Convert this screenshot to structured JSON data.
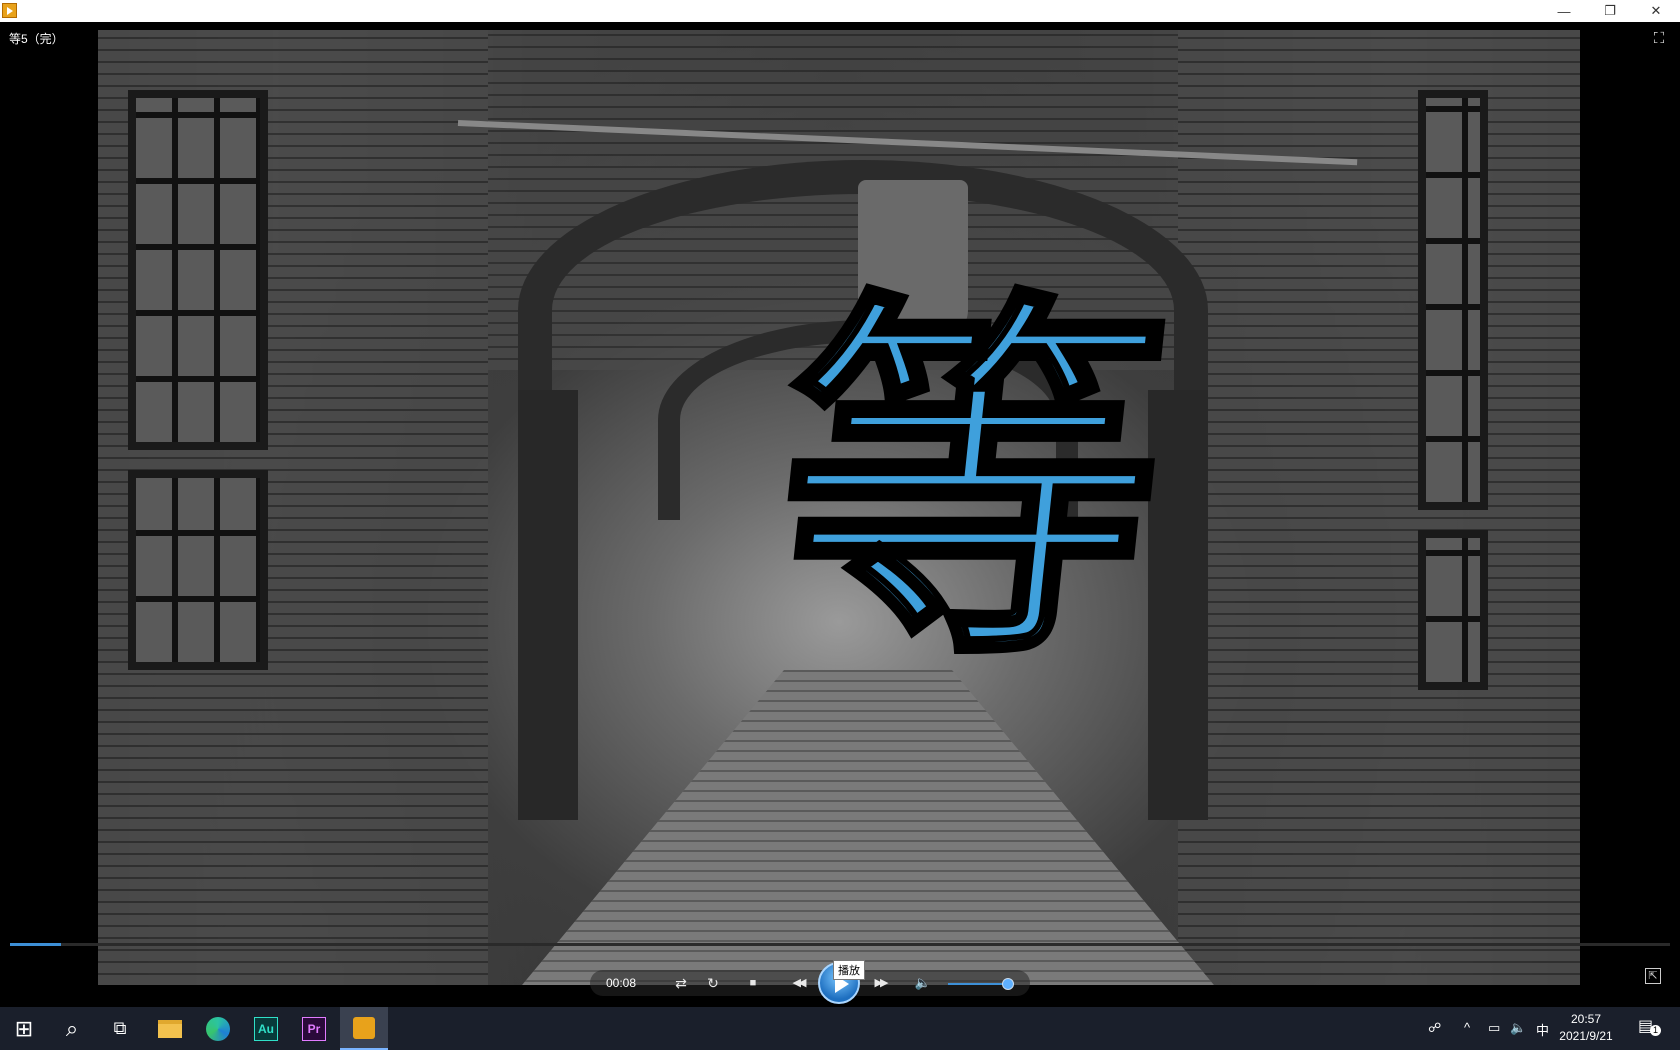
{
  "window": {
    "minimize_glyph": "—",
    "restore_glyph": "❐",
    "close_glyph": "✕"
  },
  "player": {
    "file_title": "等5（完）",
    "overlay_character": "等",
    "current_time": "00:08",
    "play_tooltip": "播放",
    "progress_fraction": 0.031,
    "volume_fraction": 0.92
  },
  "controls": {
    "repeat_glyph": "⇄",
    "reload_glyph": "↻",
    "stop_glyph": "■",
    "rewind_glyph": "◀◀",
    "forward_glyph": "▶▶",
    "volume_glyph": "🔈",
    "fullscreen_glyph": "⛶",
    "pip_glyph": "⇱"
  },
  "taskbar": {
    "start_glyph": "⊞",
    "search_glyph": "⌕",
    "taskview_glyph": "⧉",
    "apps": [
      {
        "name": "file-explorer",
        "label": ""
      },
      {
        "name": "edge",
        "label": ""
      },
      {
        "name": "audition",
        "label": "Au"
      },
      {
        "name": "premiere",
        "label": "Pr"
      },
      {
        "name": "media-player",
        "label": ""
      }
    ],
    "tray": {
      "chevron": "^",
      "ime": "中",
      "time": "20:57",
      "date": "2021/9/21",
      "notification_count": "1"
    }
  },
  "colors": {
    "accent": "#3d8fd6",
    "glyph": "#3fa0dc",
    "taskbar": "#1a1f2b"
  }
}
